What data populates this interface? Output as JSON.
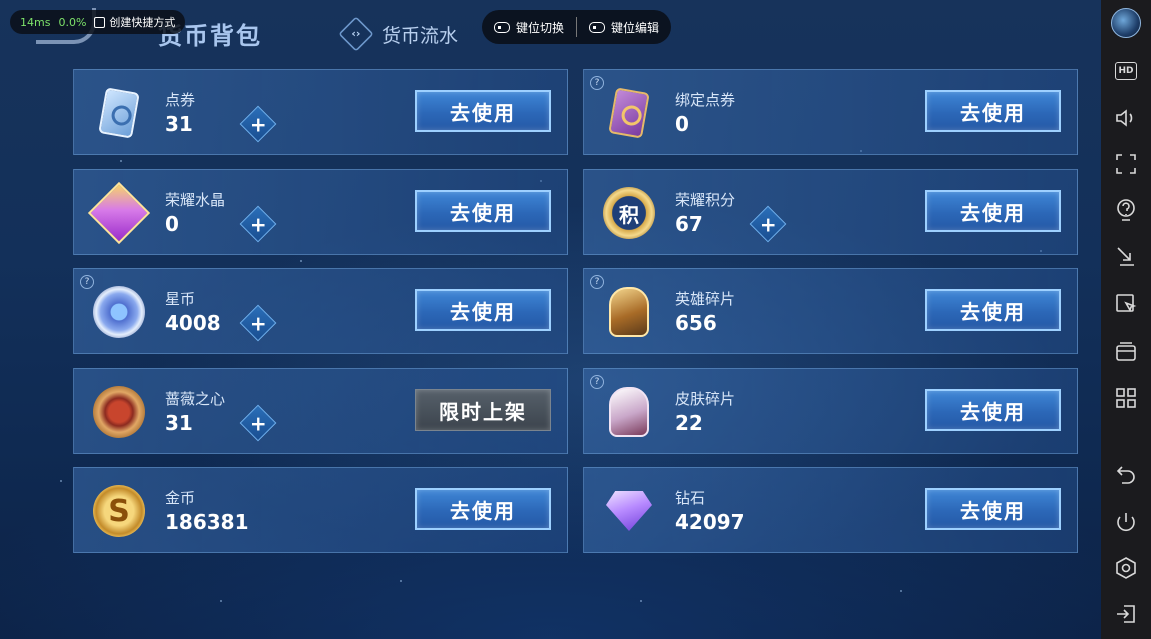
{
  "header": {
    "title": "货币背包",
    "flow_tab_label": "货币流水",
    "flow_tab_glyph": "‹›"
  },
  "perf_overlay": {
    "latency": "14ms",
    "usage": "0.0%",
    "shortcut_label": "创建快捷方式"
  },
  "keymap_bar": {
    "switch_label": "键位切换",
    "edit_label": "键位编辑"
  },
  "currencies": [
    {
      "name": "点券",
      "value": "31",
      "has_plus": true,
      "has_help": false,
      "action": "去使用",
      "icon": "ticket-icon"
    },
    {
      "name": "绑定点券",
      "value": "0",
      "has_plus": false,
      "has_help": true,
      "action": "去使用",
      "icon": "bound-ticket-icon"
    },
    {
      "name": "荣耀水晶",
      "value": "0",
      "has_plus": true,
      "has_help": false,
      "action": "去使用",
      "icon": "crystal-icon"
    },
    {
      "name": "荣耀积分",
      "value": "67",
      "has_plus": true,
      "has_help": false,
      "action": "去使用",
      "icon": "points-coin-icon",
      "icon_text": "积"
    },
    {
      "name": "星币",
      "value": "4008",
      "has_plus": true,
      "has_help": true,
      "action": "去使用",
      "icon": "star-coin-icon"
    },
    {
      "name": "英雄碎片",
      "value": "656",
      "has_plus": false,
      "has_help": true,
      "action": "去使用",
      "icon": "hero-shard-icon"
    },
    {
      "name": "蔷薇之心",
      "value": "31",
      "has_plus": true,
      "has_help": false,
      "action": "限时上架",
      "icon": "rose-heart-icon"
    },
    {
      "name": "皮肤碎片",
      "value": "22",
      "has_plus": false,
      "has_help": true,
      "action": "去使用",
      "icon": "skin-shard-icon"
    },
    {
      "name": "金币",
      "value": "186381",
      "has_plus": false,
      "has_help": false,
      "action": "去使用",
      "icon": "gold-coin-icon",
      "icon_text": "S"
    },
    {
      "name": "钻石",
      "value": "42097",
      "has_plus": false,
      "has_help": false,
      "action": "去使用",
      "icon": "diamond-icon"
    }
  ],
  "help_glyph": "?",
  "plus_glyph": "+",
  "sidebar": {
    "hd_label": "HD",
    "icons": [
      "avatar",
      "hd-icon",
      "volume-icon",
      "fullscreen-icon",
      "help-icon",
      "collapse-icon",
      "screenshot-icon",
      "window-icon",
      "apps-icon",
      "back-icon",
      "power-icon",
      "home-icon",
      "exit-icon"
    ]
  },
  "colors": {
    "accent_button": "#2c68b8",
    "button_border": "#9dd0ff",
    "limited_button": "#3c444d",
    "latency_text": "#7de16a"
  }
}
